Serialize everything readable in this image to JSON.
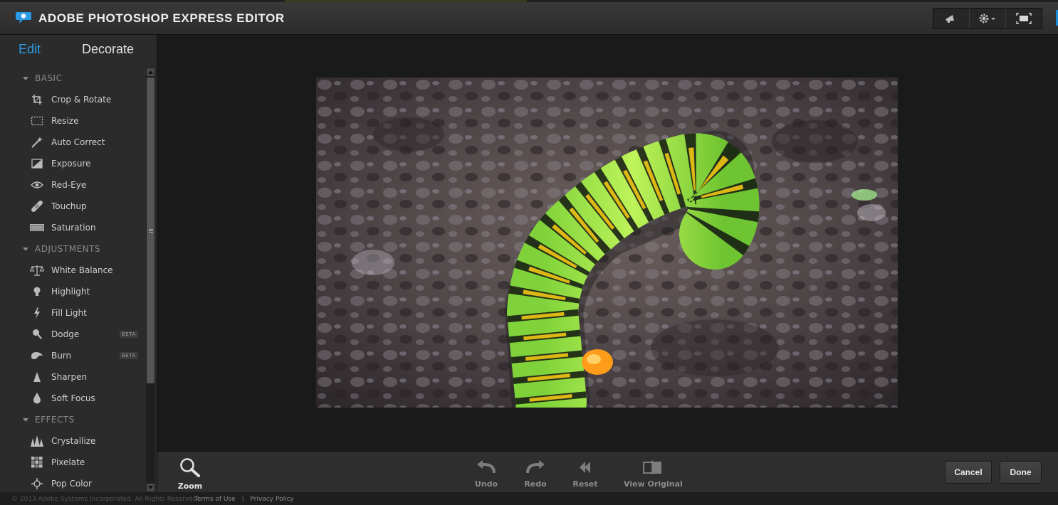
{
  "app": {
    "title": "ADOBE PHOTOSHOP EXPRESS EDITOR"
  },
  "header": {
    "tools": [
      {
        "icon": "megaphone-icon"
      },
      {
        "icon": "gear-icon"
      },
      {
        "icon": "fullscreen-icon"
      }
    ]
  },
  "sidebar": {
    "tabs": {
      "edit": "Edit",
      "decorate": "Decorate",
      "active": "Edit"
    },
    "sections": [
      {
        "title": "BASIC",
        "items": [
          {
            "label": "Crop & Rotate",
            "icon": "crop-icon"
          },
          {
            "label": "Resize",
            "icon": "resize-icon"
          },
          {
            "label": "Auto Correct",
            "icon": "magic-wand-icon"
          },
          {
            "label": "Exposure",
            "icon": "exposure-icon"
          },
          {
            "label": "Red-Eye",
            "icon": "eye-icon"
          },
          {
            "label": "Touchup",
            "icon": "bandage-icon"
          },
          {
            "label": "Saturation",
            "icon": "saturation-icon"
          }
        ]
      },
      {
        "title": "ADJUSTMENTS",
        "items": [
          {
            "label": "White Balance",
            "icon": "balance-scale-icon"
          },
          {
            "label": "Highlight",
            "icon": "lightbulb-icon"
          },
          {
            "label": "Fill Light",
            "icon": "lightning-icon"
          },
          {
            "label": "Dodge",
            "icon": "dodge-icon",
            "badge": "BETA"
          },
          {
            "label": "Burn",
            "icon": "burn-icon",
            "badge": "BETA"
          },
          {
            "label": "Sharpen",
            "icon": "sharpen-icon"
          },
          {
            "label": "Soft Focus",
            "icon": "droplet-icon"
          }
        ]
      },
      {
        "title": "EFFECTS",
        "items": [
          {
            "label": "Crystallize",
            "icon": "crystallize-icon"
          },
          {
            "label": "Pixelate",
            "icon": "pixelate-icon"
          },
          {
            "label": "Pop Color",
            "icon": "pop-color-icon"
          }
        ]
      }
    ]
  },
  "toolbar": {
    "zoom": "Zoom",
    "undo": "Undo",
    "redo": "Redo",
    "reset": "Reset",
    "view_original": "View Original",
    "cancel": "Cancel",
    "done": "Done"
  },
  "footer": {
    "copyright": "© 2013 Adobe Systems Incorporated. All Rights Reserved.",
    "terms": "Terms of Use",
    "separator": "|",
    "privacy": "Privacy Policy"
  },
  "colors": {
    "accent": "#2c9be6",
    "background": "#1b1b1b",
    "panel": "#2b2b2b"
  }
}
